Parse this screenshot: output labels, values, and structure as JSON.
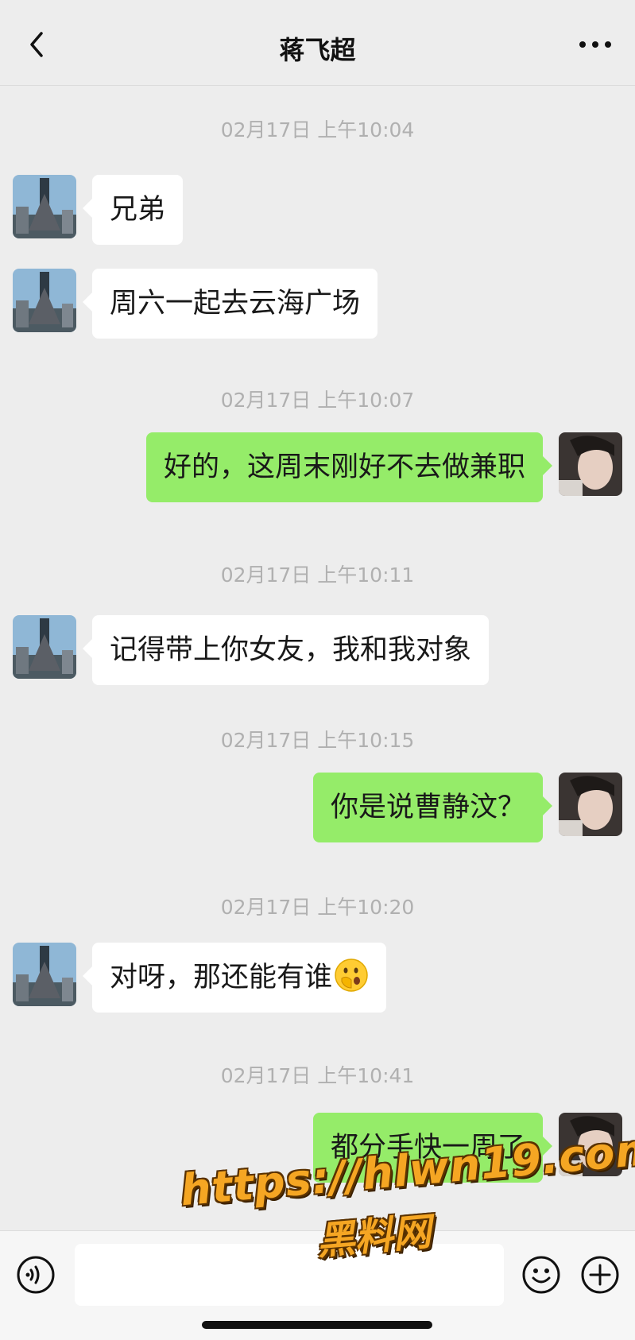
{
  "header": {
    "title": "蒋飞超",
    "back_icon": "chevron-left-icon",
    "more_icon": "more-dots-icon"
  },
  "messages": [
    {
      "type": "timestamp",
      "text": "02月17日 上午10:04"
    },
    {
      "type": "message",
      "direction": "in",
      "text": "兄弟"
    },
    {
      "type": "message",
      "direction": "in",
      "text": "周六一起去云海广场"
    },
    {
      "type": "timestamp",
      "text": "02月17日 上午10:07"
    },
    {
      "type": "message",
      "direction": "out",
      "text": "好的，这周末刚好不去做兼职"
    },
    {
      "type": "timestamp",
      "text": "02月17日 上午10:11"
    },
    {
      "type": "message",
      "direction": "in",
      "text": "记得带上你女友，我和我对象"
    },
    {
      "type": "timestamp",
      "text": "02月17日 上午10:15"
    },
    {
      "type": "message",
      "direction": "out",
      "text": "你是说曹静汶？"
    },
    {
      "type": "timestamp",
      "text": "02月17日 上午10:20"
    },
    {
      "type": "message",
      "direction": "in",
      "text": "对呀，那还能有谁",
      "emoji": "face-with-hand-over-mouth-icon"
    },
    {
      "type": "timestamp",
      "text": "02月17日 上午10:41"
    },
    {
      "type": "message",
      "direction": "out",
      "text": "都分手快一周了"
    }
  ],
  "footer": {
    "input_value": "",
    "voice_icon": "voice-icon",
    "emoji_icon": "smiley-icon",
    "plus_icon": "plus-circle-icon"
  },
  "watermark": {
    "url": "https://hlwn19.com",
    "label": "黑料网"
  },
  "colors": {
    "background": "#ededed",
    "bubble_in": "#ffffff",
    "bubble_out": "#95ec69",
    "timestamp": "#b0b0b0",
    "watermark": "#f5a623"
  }
}
